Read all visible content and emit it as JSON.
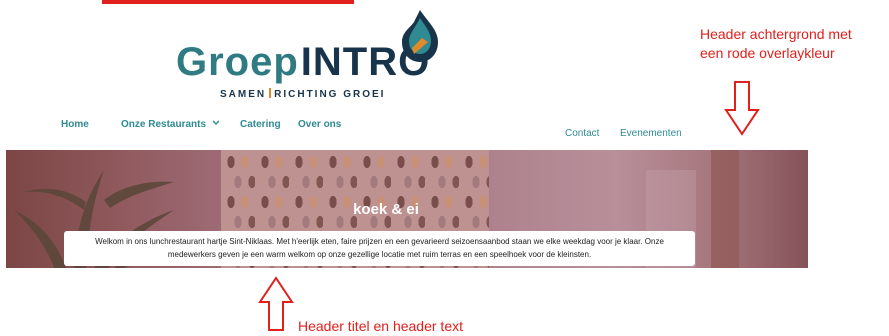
{
  "logo": {
    "word_left": "Groep",
    "word_right": "INTRO",
    "tagline_left": "SAMEN",
    "tagline_right": "RICHTING GROEI"
  },
  "nav": {
    "home": "Home",
    "restaurants": "Onze Restaurants",
    "restaurants_icon": "chevron-down-icon",
    "catering": "Catering",
    "over_ons": "Over ons",
    "contact": "Contact",
    "evenementen": "Evenementen"
  },
  "header": {
    "title": "koek & ei",
    "text": "Welkom in ons lunchrestaurant hartje Sint-Niklaas. Met h'eerlijk eten, faire prijzen en een gevarieerd seizoensaanbod staan we elke weekdag voor je klaar. Onze medewerkers geven je een warm welkom op onze gezellige locatie met ruim terras en een speelhoek voor de kleinsten."
  },
  "annotations": {
    "right_line1": "Header achtergrond met",
    "right_line2": "een rode overlaykleur",
    "bottom": "Header titel en header text"
  },
  "colors": {
    "annotation": "#e0201c",
    "nav": "#2f8a91",
    "logo_teal": "#2f7a83",
    "logo_navy": "#18344a",
    "overlay": "rgba(160, 60, 90, 0.28)"
  }
}
